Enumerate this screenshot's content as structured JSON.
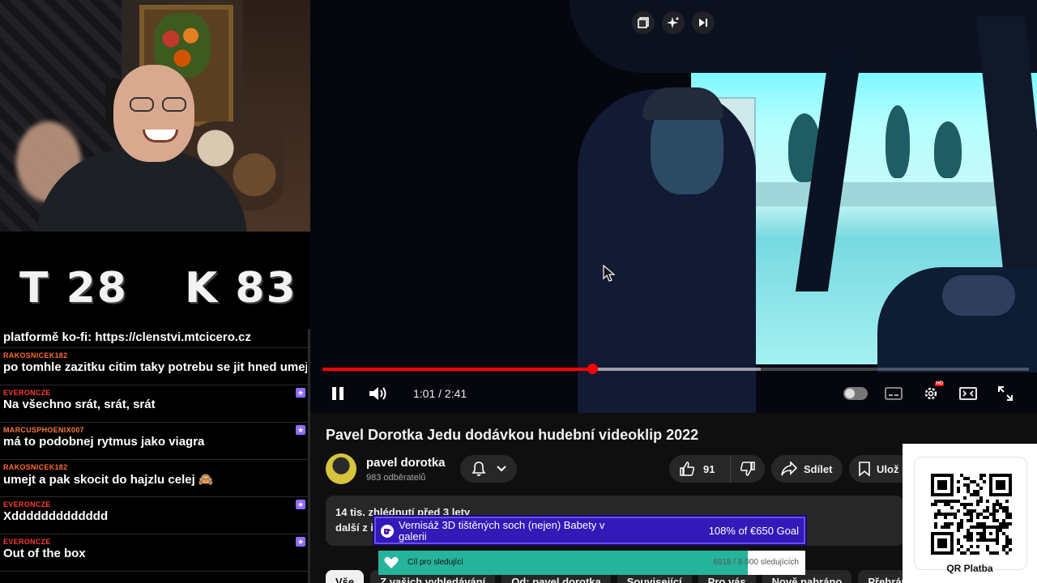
{
  "scores": {
    "t": "T 28",
    "k": "K 83"
  },
  "chat": [
    {
      "user": "",
      "text": "platformě ko-fi: https://clenstvi.mtcicero.cz",
      "color": "#ffffff",
      "badge": false
    },
    {
      "user": "RAKOSNICEK182",
      "text": "po tomhle zazitku citim taky potrebu se jit hned umejt",
      "color": "#ff6a2b",
      "badge": false
    },
    {
      "user": "EVERONCZE",
      "text": "Na všechno srát, srát, srát",
      "color": "#ff3b2f",
      "badge": true
    },
    {
      "user": "MARCUSPHOENIX007",
      "text": "má to podobnej rytmus jako viagra",
      "color": "#ff7a3c",
      "badge": true
    },
    {
      "user": "RAKOSNICEK182",
      "text": "umejt a pak skocit do hajzlu celej 🙈",
      "color": "#ff6a2b",
      "badge": false
    },
    {
      "user": "EVERONCZE",
      "text": "Xddddddddddddd",
      "color": "#ff3b2f",
      "badge": true
    },
    {
      "user": "EVERONCZE",
      "text": "Out of the box",
      "color": "#ff3b2f",
      "badge": true
    }
  ],
  "player": {
    "time_current": "1:01",
    "time_separator": "/",
    "time_total": "2:41",
    "progress_played": 0.382,
    "progress_buffered": 0.62,
    "top_icons": [
      "playlist-add-icon",
      "sparkle-icon",
      "next-icon"
    ]
  },
  "video": {
    "title": "Pavel Dorotka Jedu dodávkou hudební videoklip 2022",
    "channel": "pavel dorotka",
    "subscribers": "983 odběratelů",
    "likes": "91",
    "share_label": "Sdílet",
    "save_label": "Ulož",
    "views_line": "14 tis. zhlédnutí  před 3 lety",
    "more_line": "další z ř"
  },
  "chips": [
    "Vše",
    "Z vašich vyhledávání",
    "Od: pavel dorotka",
    "Související",
    "Pro vás",
    "Nově nahráno",
    "Přehráno"
  ],
  "goal": {
    "title": "Vernisáž 3D tištěných soch (nejen) Babety v galerii",
    "percent": "108% of €650 Goal"
  },
  "follow_goal": {
    "label": "Cíl pro sledující",
    "count": "6918 / 8 000 sledujících",
    "progress": 0.865
  },
  "qr": {
    "label": "QR Platba"
  },
  "colors": {
    "accent": "#ff0000",
    "goal_bg": "#3319b8",
    "follow_fill": "#26b39b"
  }
}
